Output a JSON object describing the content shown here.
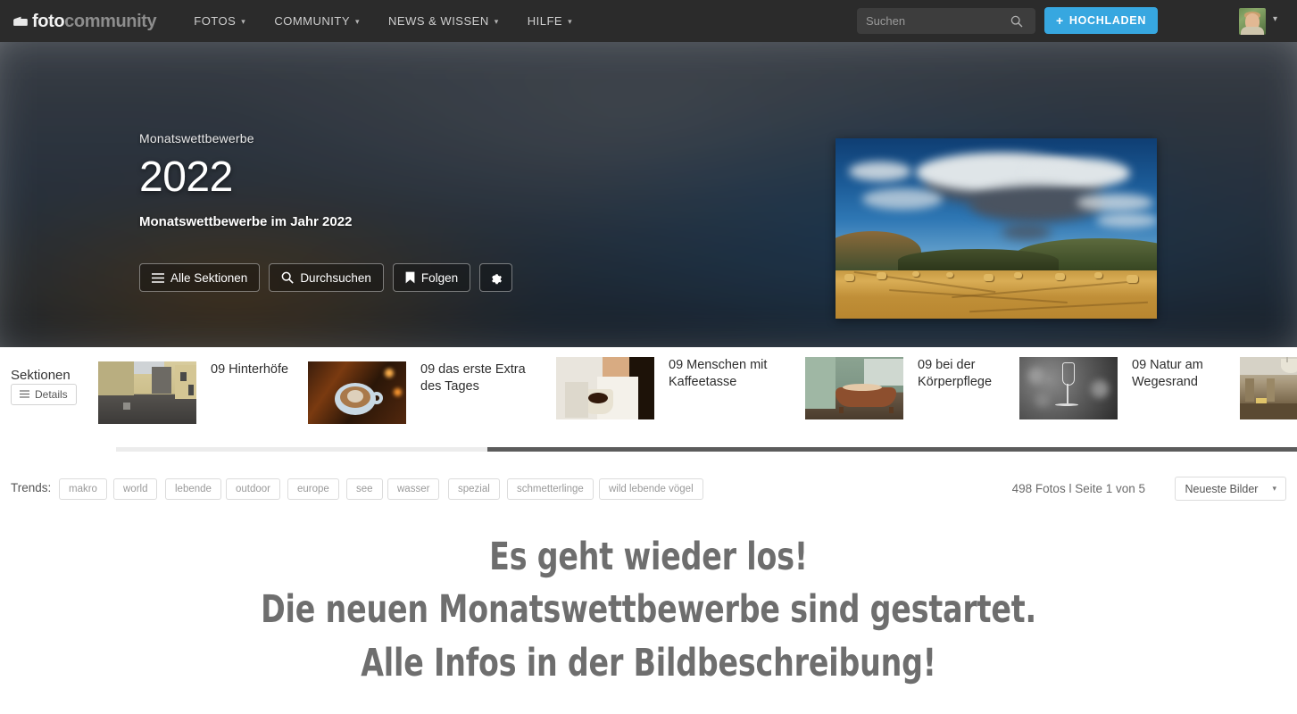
{
  "header": {
    "logo": {
      "part1": "foto",
      "part2": "community",
      "icon": "camera-icon"
    },
    "nav": [
      {
        "label": "FOTOS",
        "caret": "⌄"
      },
      {
        "label": "COMMUNITY",
        "caret": "⌄"
      },
      {
        "label": "NEWS & WISSEN",
        "caret": "⌄"
      },
      {
        "label": "HILFE",
        "caret": "⌄"
      }
    ],
    "search": {
      "placeholder": "Suchen",
      "value": "",
      "icon": "search-icon"
    },
    "upload_button": {
      "label": "HOCHLADEN",
      "plus": "+",
      "color": "#37a7e0"
    },
    "user": {
      "avatar": "user-avatar",
      "caret": "⌄"
    }
  },
  "hero": {
    "kicker": "Monatswettbewerbe",
    "title": "2022",
    "subtitle": "Monatswettbewerbe im Jahr 2022",
    "buttons": [
      {
        "label": "Alle Sektionen",
        "icon": "hamburger-icon"
      },
      {
        "label": "Durchsuchen",
        "icon": "search-icon"
      },
      {
        "label": "Folgen",
        "icon": "bookmark-icon"
      },
      {
        "label": "",
        "icon": "gear-icon"
      }
    ],
    "photo_alt": "landscape-hay-field-clouds"
  },
  "sections": {
    "label": "Sektionen",
    "details_button": {
      "label": "Details",
      "icon": "hamburger-icon"
    },
    "items": [
      {
        "title": "09 Hinterhöfe",
        "thumb": "courtyard-thumb"
      },
      {
        "title": "09 das erste Extra des Tages",
        "thumb": "coffee-cup-thumb"
      },
      {
        "title": "09 Menschen mit Kaffeetasse",
        "thumb": "woman-coffee-thumb"
      },
      {
        "title": "09 bei der Körperpflege",
        "thumb": "bathtub-thumb"
      },
      {
        "title": "09 Natur am Wegesrand",
        "thumb": "bw-nature-thumb"
      },
      {
        "title": "",
        "thumb": "interior-hall-thumb"
      }
    ]
  },
  "trends": {
    "label": "Trends:",
    "tags": [
      "makro",
      "world",
      "lebende",
      "outdoor",
      "europe",
      "see",
      "wasser",
      "spezial",
      "schmetterlinge",
      "wild lebende vögel"
    ],
    "page_info": "498 Fotos l Seite 1 von 5",
    "sort": {
      "value": "Neueste Bilder",
      "caret": "▾"
    }
  },
  "headline": {
    "line1": "Es geht wieder los!",
    "line2": "Die neuen Monatswettbewerbe sind gestartet.",
    "line3": "Alle Infos in der Bildbeschreibung!"
  }
}
